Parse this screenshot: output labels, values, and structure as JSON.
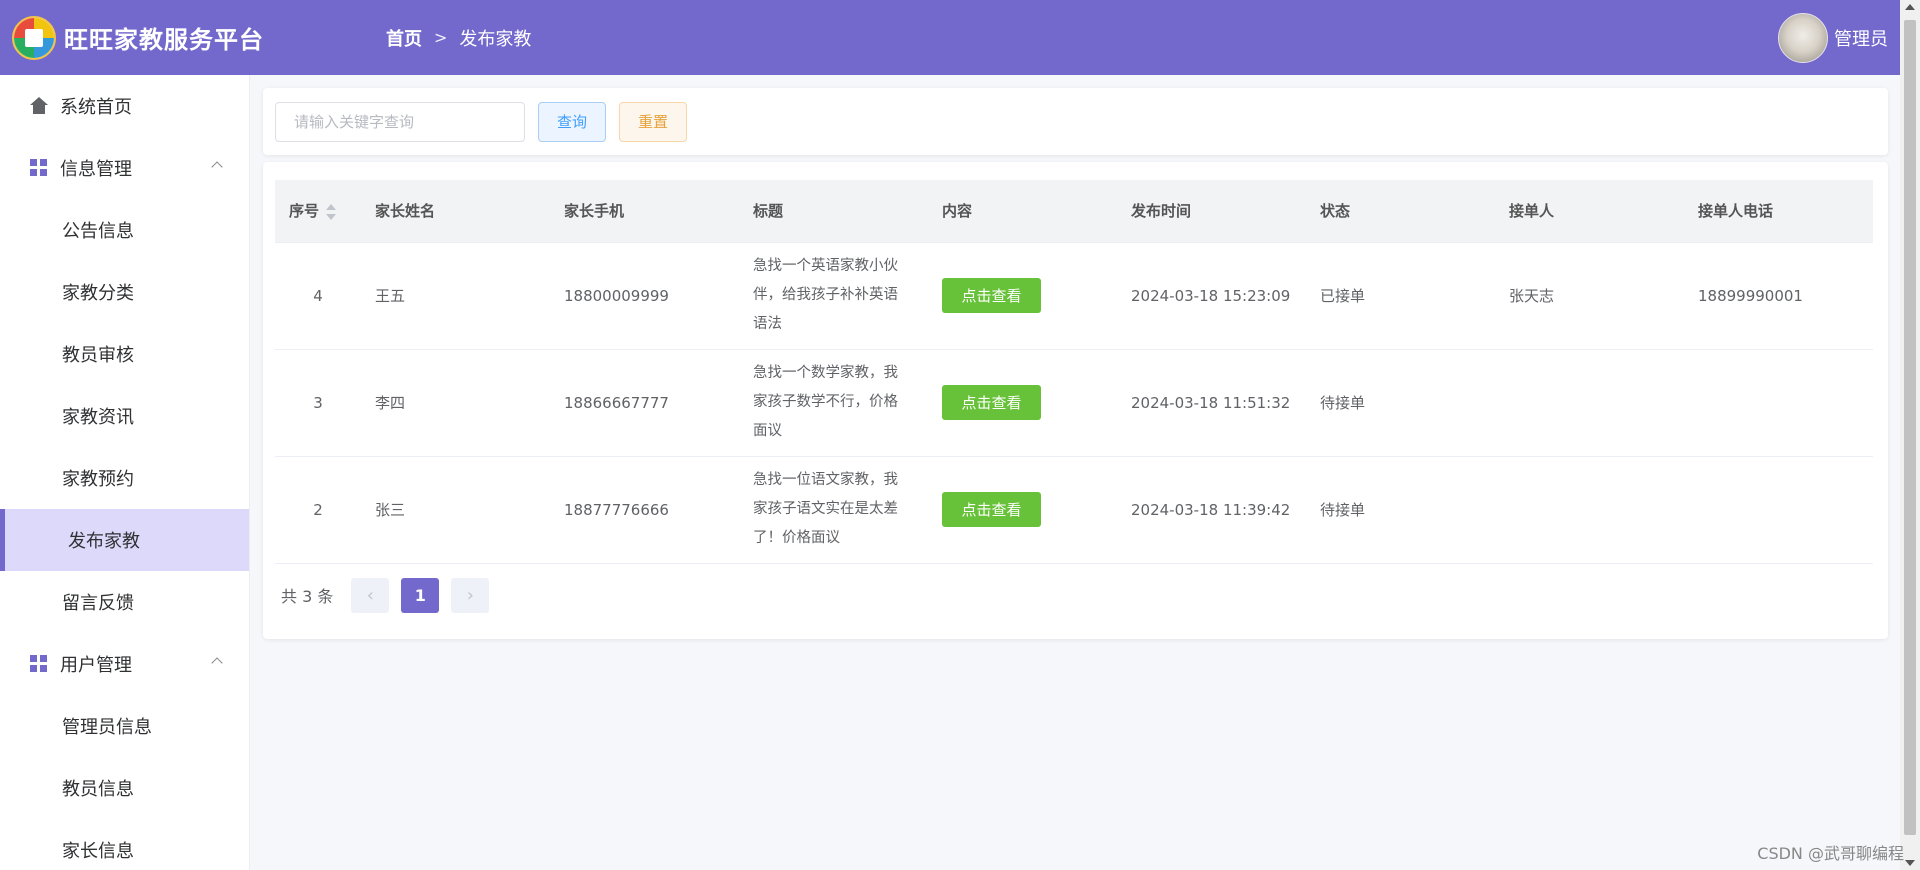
{
  "header": {
    "app_title": "旺旺家教服务平台",
    "breadcrumb_home": "首页",
    "breadcrumb_sep": ">",
    "breadcrumb_current": "发布家教",
    "user_name": "管理员",
    "colors": {
      "header_bg": "#7369cc",
      "accent": "#7369cc"
    }
  },
  "sidebar": {
    "home": {
      "label": "系统首页",
      "icon": "home-icon"
    },
    "info_group": {
      "label": "信息管理",
      "icon": "grid-icon"
    },
    "info_items": [
      "公告信息",
      "家教分类",
      "教员审核",
      "家教资讯",
      "家教预约",
      "发布家教",
      "留言反馈"
    ],
    "active_item": "发布家教",
    "user_group": {
      "label": "用户管理",
      "icon": "grid-icon"
    },
    "user_items": [
      "管理员信息",
      "教员信息",
      "家长信息"
    ]
  },
  "search": {
    "placeholder": "请输入关键字查询",
    "value": "",
    "query_label": "查询",
    "reset_label": "重置"
  },
  "table": {
    "columns": [
      "序号",
      "家长姓名",
      "家长手机",
      "标题",
      "内容",
      "发布时间",
      "状态",
      "接单人",
      "接单人电话"
    ],
    "view_label": "点击查看",
    "rows": [
      {
        "idx": "4",
        "parent": "王五",
        "phone": "18800009999",
        "title": "急找一个英语家教小伙伴，给我孩子补补英语语法",
        "time": "2024-03-18 15:23:09",
        "status": "已接单",
        "taker": "张天志",
        "taker_phone": "18899990001"
      },
      {
        "idx": "3",
        "parent": "李四",
        "phone": "18866667777",
        "title": "急找一个数学家教，我家孩子数学不行，价格面议",
        "time": "2024-03-18 11:51:32",
        "status": "待接单",
        "taker": "",
        "taker_phone": ""
      },
      {
        "idx": "2",
        "parent": "张三",
        "phone": "18877776666",
        "title": "急找一位语文家教，我家孩子语文实在是太差了！价格面议",
        "time": "2024-03-18 11:39:42",
        "status": "待接单",
        "taker": "",
        "taker_phone": ""
      }
    ]
  },
  "pagination": {
    "total_text": "共 3 条",
    "current_page": "1",
    "prev": "‹",
    "next": "›"
  },
  "watermark": "CSDN @武哥聊编程"
}
